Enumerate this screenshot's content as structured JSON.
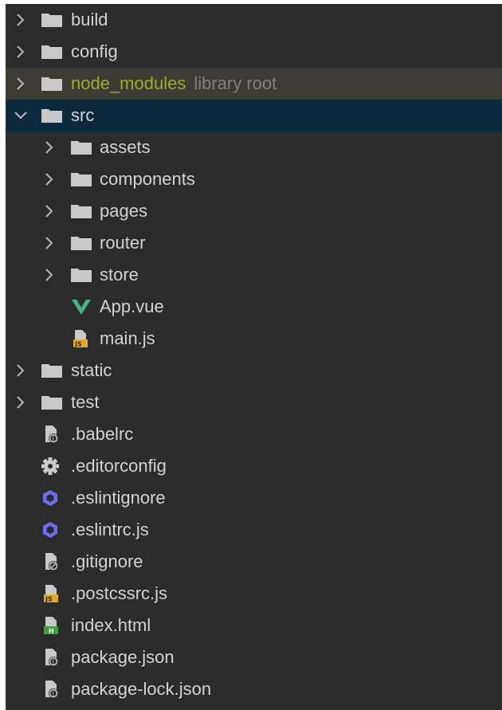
{
  "project_tree": {
    "items": [
      {
        "label": "build",
        "icon": "folder-icon",
        "depth": 0,
        "expanded": false
      },
      {
        "label": "config",
        "icon": "folder-icon",
        "depth": 0,
        "expanded": false
      },
      {
        "label": "node_modules",
        "suffix": "library root",
        "icon": "folder-icon",
        "depth": 0,
        "expanded": false,
        "style": "excluded"
      },
      {
        "label": "src",
        "icon": "folder-icon",
        "depth": 0,
        "expanded": true,
        "selected": true
      },
      {
        "label": "assets",
        "icon": "folder-icon",
        "depth": 1,
        "expanded": false
      },
      {
        "label": "components",
        "icon": "folder-icon",
        "depth": 1,
        "expanded": false
      },
      {
        "label": "pages",
        "icon": "folder-icon",
        "depth": 1,
        "expanded": false
      },
      {
        "label": "router",
        "icon": "folder-icon",
        "depth": 1,
        "expanded": false
      },
      {
        "label": "store",
        "icon": "folder-icon",
        "depth": 1,
        "expanded": false
      },
      {
        "label": "App.vue",
        "icon": "vue-file-icon",
        "depth": 1
      },
      {
        "label": "main.js",
        "icon": "js-file-icon",
        "depth": 1
      },
      {
        "label": "static",
        "icon": "folder-icon",
        "depth": 0,
        "expanded": false
      },
      {
        "label": "test",
        "icon": "folder-icon",
        "depth": 0,
        "expanded": false
      },
      {
        "label": ".babelrc",
        "icon": "json-config-file-icon",
        "depth": 0
      },
      {
        "label": ".editorconfig",
        "icon": "gear-icon",
        "depth": 0
      },
      {
        "label": ".eslintignore",
        "icon": "eslint-icon",
        "depth": 0
      },
      {
        "label": ".eslintrc.js",
        "icon": "eslint-icon",
        "depth": 0
      },
      {
        "label": ".gitignore",
        "icon": "ignore-file-icon",
        "depth": 0
      },
      {
        "label": ".postcssrc.js",
        "icon": "js-file-icon",
        "depth": 0
      },
      {
        "label": "index.html",
        "icon": "html-file-icon",
        "depth": 0
      },
      {
        "label": "package.json",
        "icon": "json-config-file-icon",
        "depth": 0
      },
      {
        "label": "package-lock.json",
        "icon": "json-config-file-icon",
        "depth": 0
      }
    ]
  },
  "colors": {
    "panel_bg": "#2b2b2b",
    "selected_bg": "#0d293e",
    "excluded_bg": "#3c3b34",
    "excluded_text": "#a1ad28",
    "text": "#d3d3d3",
    "muted_text": "#808080",
    "folder": "#c9c9c9",
    "vue_green": "#41b883",
    "js_badge": "#e0a92b",
    "html_badge": "#3f9f38",
    "eslint_purple": "#6c6cf0"
  }
}
